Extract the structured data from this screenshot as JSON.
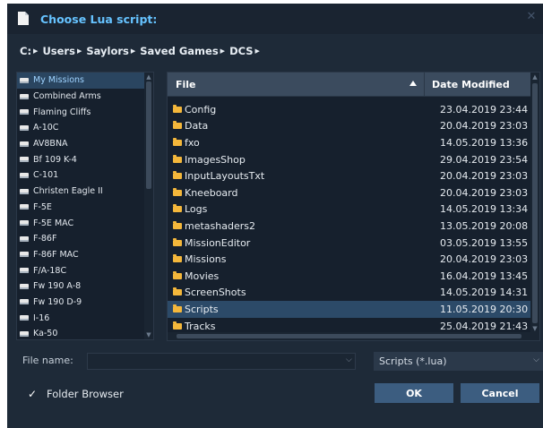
{
  "window": {
    "title": "Choose Lua script:",
    "close_glyph": "✕"
  },
  "breadcrumb": [
    {
      "label": "C:"
    },
    {
      "label": "Users"
    },
    {
      "label": "Saylors"
    },
    {
      "label": "Saved Games"
    },
    {
      "label": "DCS"
    }
  ],
  "sidebar": {
    "items": [
      {
        "label": "My Missions",
        "selected": true
      },
      {
        "label": "Combined Arms"
      },
      {
        "label": "Flaming Cliffs"
      },
      {
        "label": "A-10C"
      },
      {
        "label": "AV8BNA"
      },
      {
        "label": "Bf 109 K-4"
      },
      {
        "label": "C-101"
      },
      {
        "label": "Christen Eagle II"
      },
      {
        "label": "F-5E"
      },
      {
        "label": "F-5E MAC"
      },
      {
        "label": "F-86F"
      },
      {
        "label": "F-86F MAC"
      },
      {
        "label": "F/A-18C"
      },
      {
        "label": "Fw 190 A-8"
      },
      {
        "label": "Fw 190 D-9"
      },
      {
        "label": "I-16"
      },
      {
        "label": "Ka-50"
      }
    ]
  },
  "file_list": {
    "columns": {
      "file": "File",
      "date": "Date Modified"
    },
    "rows": [
      {
        "name": "Config",
        "date": "23.04.2019 23:44"
      },
      {
        "name": "Data",
        "date": "20.04.2019 23:03"
      },
      {
        "name": "fxo",
        "date": "14.05.2019 13:36"
      },
      {
        "name": "ImagesShop",
        "date": "29.04.2019 23:54"
      },
      {
        "name": "InputLayoutsTxt",
        "date": "20.04.2019 23:03"
      },
      {
        "name": "Kneeboard",
        "date": "20.04.2019 23:03"
      },
      {
        "name": "Logs",
        "date": "14.05.2019 13:34"
      },
      {
        "name": "metashaders2",
        "date": "13.05.2019 20:08"
      },
      {
        "name": "MissionEditor",
        "date": "03.05.2019 13:55"
      },
      {
        "name": "Missions",
        "date": "20.04.2019 23:03"
      },
      {
        "name": "Movies",
        "date": "16.04.2019 13:45"
      },
      {
        "name": "ScreenShots",
        "date": "14.05.2019 14:31"
      },
      {
        "name": "Scripts",
        "date": "11.05.2019 20:30",
        "selected": true
      },
      {
        "name": "Tracks",
        "date": "25.04.2019 21:43"
      }
    ]
  },
  "bottom": {
    "filename_label": "File name:",
    "filename_value": "",
    "filter_value": "Scripts (*.lua)",
    "folder_browser_label": "Folder Browser",
    "folder_browser_checked": true,
    "ok_label": "OK",
    "cancel_label": "Cancel"
  },
  "colors": {
    "title_accent": "#66c3ff",
    "folder": "#f4b73b",
    "selection": "#2c4a68",
    "button": "#3c5d80"
  },
  "icons": {
    "title": "document-icon",
    "sidebar_item": "drive-icon",
    "file_row": "folder-icon",
    "sort": "sort-ascending-icon"
  }
}
